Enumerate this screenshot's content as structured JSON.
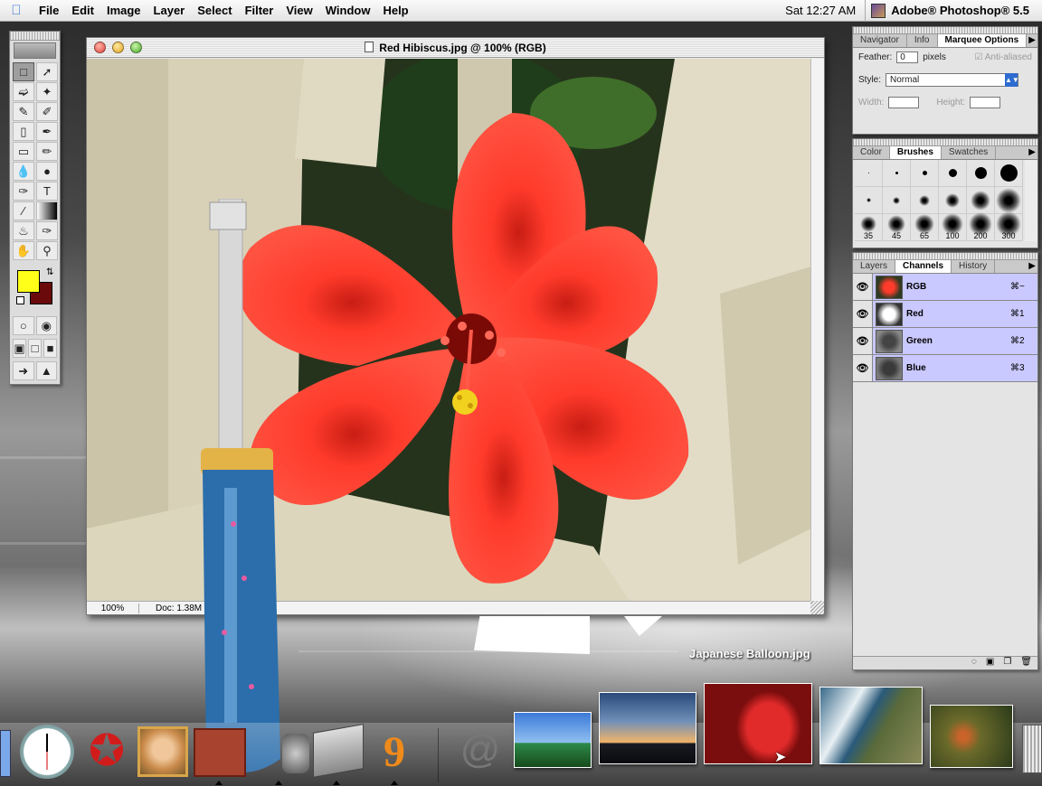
{
  "menubar": {
    "apple_icon": "apple-icon",
    "items": [
      "File",
      "Edit",
      "Image",
      "Layer",
      "Select",
      "Filter",
      "View",
      "Window",
      "Help"
    ],
    "clock": "Sat 12:27 AM",
    "app_name": "Adobe® Photoshop® 5.5"
  },
  "document": {
    "title": "Red Hibiscus.jpg @ 100% (RGB)",
    "zoom": "100%",
    "doc_info": "Doc: 1.38M"
  },
  "tools": {
    "foreground_color": "#ffff1a",
    "background_color": "#6a0a0a",
    "icons": [
      "marquee-icon",
      "move-icon",
      "lasso-icon",
      "magic-wand-icon",
      "airbrush-icon",
      "paintbrush-icon",
      "rubber-stamp-icon",
      "history-brush-icon",
      "eraser-icon",
      "pencil-icon",
      "blur-icon",
      "burn-icon",
      "pen-icon",
      "type-icon",
      "measure-icon",
      "gradient-icon",
      "paint-bucket-icon",
      "eyedropper-icon",
      "hand-icon",
      "zoom-icon"
    ]
  },
  "marquee_palette": {
    "tabs": [
      "Navigator",
      "Info",
      "Marquee Options"
    ],
    "feather_label": "Feather:",
    "feather_value": "0",
    "feather_unit": "pixels",
    "antialiased_label": "Anti-aliased",
    "style_label": "Style:",
    "style_value": "Normal",
    "width_label": "Width:",
    "height_label": "Height:"
  },
  "brushes_palette": {
    "tabs": [
      "Color",
      "Brushes",
      "Swatches"
    ],
    "size_labels": [
      "35",
      "45",
      "65",
      "100",
      "200",
      "300"
    ]
  },
  "channels_palette": {
    "tabs": [
      "Layers",
      "Channels",
      "History"
    ],
    "channels": [
      {
        "name": "RGB",
        "shortcut": "⌘~"
      },
      {
        "name": "Red",
        "shortcut": "⌘1"
      },
      {
        "name": "Green",
        "shortcut": "⌘2"
      },
      {
        "name": "Blue",
        "shortcut": "⌘3"
      }
    ]
  },
  "desktop": {
    "balloon_label": "Japanese Balloon.jpg"
  }
}
